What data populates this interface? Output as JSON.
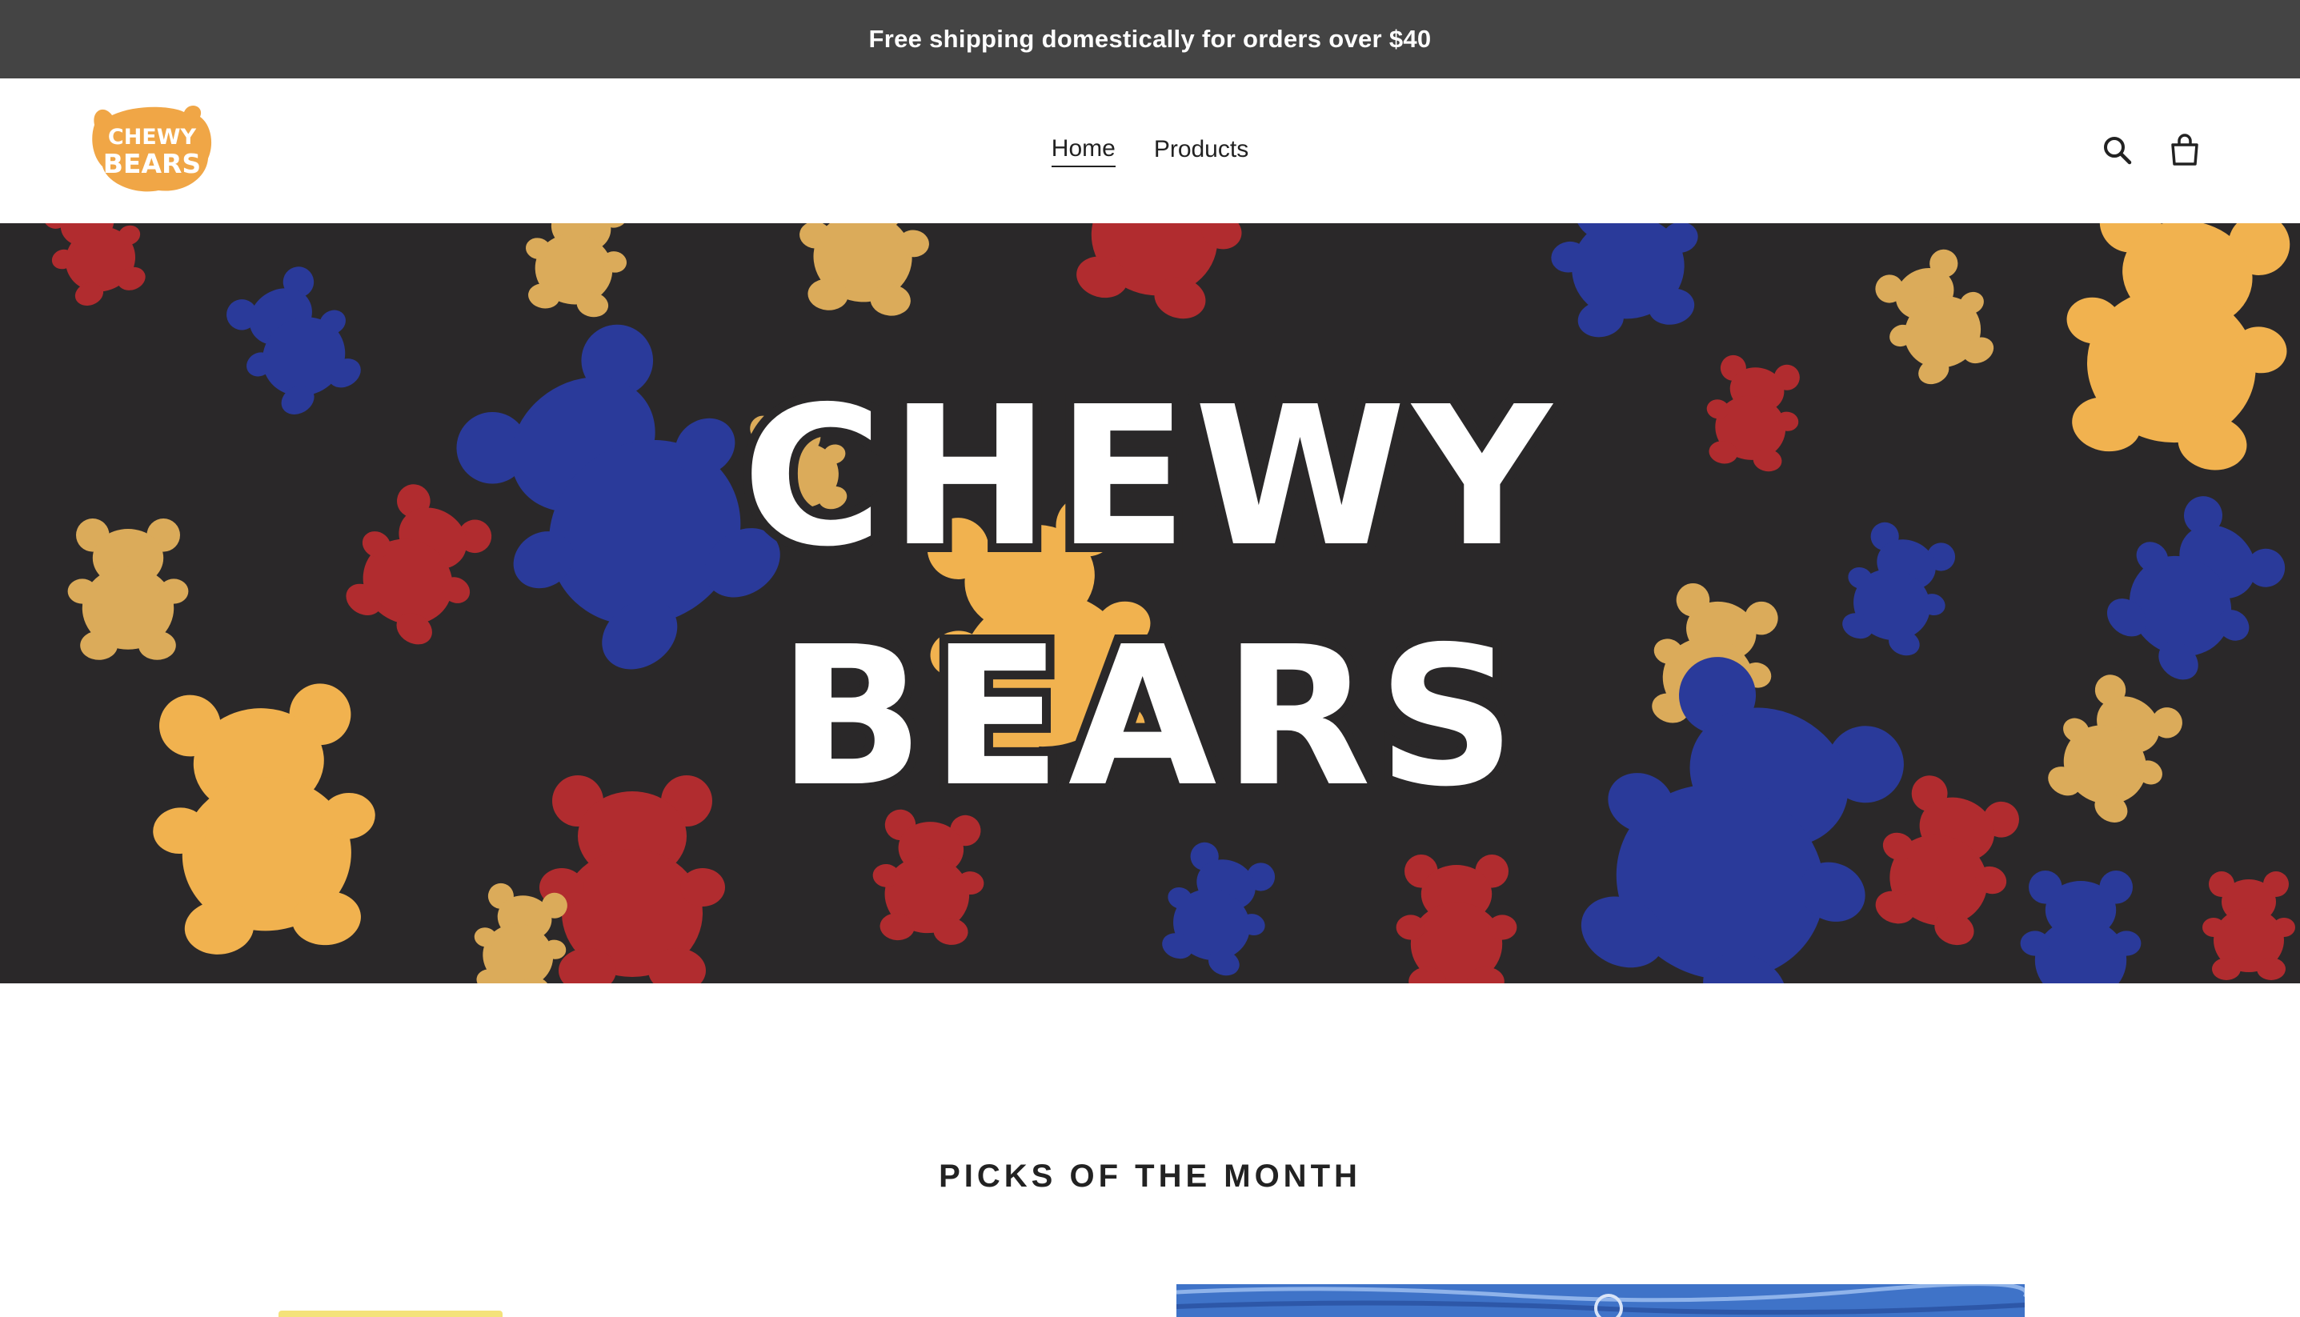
{
  "announcement": {
    "text": "Free shipping domestically for orders over $40"
  },
  "header": {
    "logo_lines": [
      "CHEWY",
      "BEARS"
    ],
    "nav": [
      {
        "label": "Home",
        "active": true
      },
      {
        "label": "Products",
        "active": false
      }
    ],
    "icons": [
      "search-icon",
      "cart-icon"
    ]
  },
  "hero": {
    "title_lines": [
      "CHEWY",
      "BEARS"
    ]
  },
  "section": {
    "title": "PICKS OF THE MONTH"
  },
  "colors": {
    "announcement_bg": "#444444",
    "hero_bg": "#2a2829",
    "bear_red": "#b12c2f",
    "bear_blue": "#2a3a9a",
    "bear_yellow": "#f1b24f",
    "bear_gold": "#dbab5a",
    "logo_orange": "#f0a646"
  }
}
